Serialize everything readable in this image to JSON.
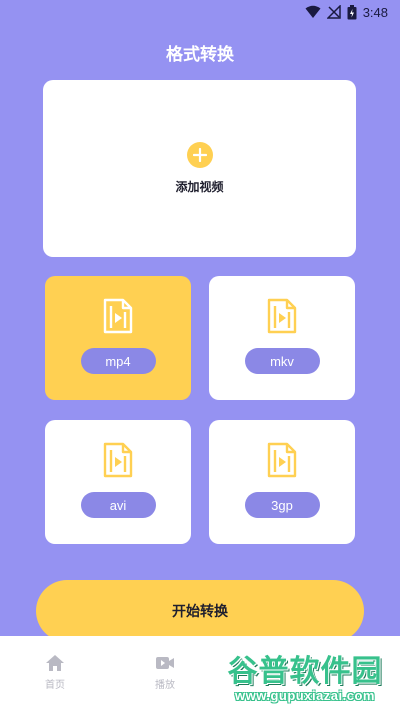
{
  "status_bar": {
    "time": "3:48"
  },
  "header": {
    "title": "格式转换"
  },
  "add_card": {
    "label": "添加视频"
  },
  "formats": [
    {
      "label": "mp4",
      "selected": true
    },
    {
      "label": "mkv",
      "selected": false
    },
    {
      "label": "avi",
      "selected": false
    },
    {
      "label": "3gp",
      "selected": false
    }
  ],
  "start_button": {
    "label": "开始转换"
  },
  "bottom_nav": {
    "items": [
      {
        "label": "首页",
        "icon": "home-icon"
      },
      {
        "label": "播放",
        "icon": "video-camera-icon"
      }
    ]
  },
  "watermark": {
    "main": "谷普软件园",
    "url": "www.gupuxiazai.com"
  },
  "colors": {
    "background": "#9592f2",
    "accent_yellow": "#ffd052",
    "pill_purple": "#8b88e6",
    "card_white": "#ffffff",
    "watermark_green": "#37c18c"
  }
}
